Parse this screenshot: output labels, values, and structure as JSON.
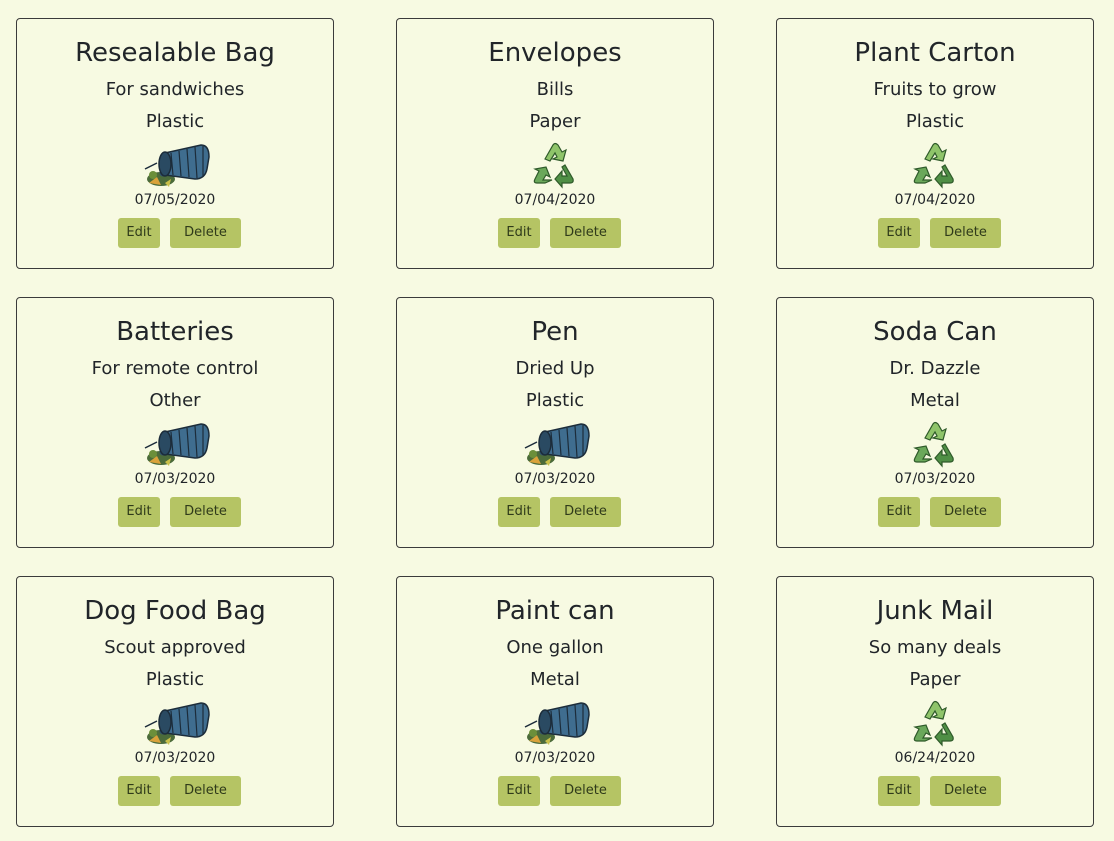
{
  "cards": [
    {
      "title": "Resealable Bag",
      "description": "For sandwiches",
      "material": "Plastic",
      "icon": "trash-can-icon",
      "date": "07/05/2020",
      "edit_label": "Edit",
      "delete_label": "Delete"
    },
    {
      "title": "Envelopes",
      "description": "Bills",
      "material": "Paper",
      "icon": "recycle-icon",
      "date": "07/04/2020",
      "edit_label": "Edit",
      "delete_label": "Delete"
    },
    {
      "title": "Plant Carton",
      "description": "Fruits to grow",
      "material": "Plastic",
      "icon": "recycle-icon",
      "date": "07/04/2020",
      "edit_label": "Edit",
      "delete_label": "Delete"
    },
    {
      "title": "Batteries",
      "description": "For remote control",
      "material": "Other",
      "icon": "trash-can-icon",
      "date": "07/03/2020",
      "edit_label": "Edit",
      "delete_label": "Delete"
    },
    {
      "title": "Pen",
      "description": "Dried Up",
      "material": "Plastic",
      "icon": "trash-can-icon",
      "date": "07/03/2020",
      "edit_label": "Edit",
      "delete_label": "Delete"
    },
    {
      "title": "Soda Can",
      "description": "Dr. Dazzle",
      "material": "Metal",
      "icon": "recycle-icon",
      "date": "07/03/2020",
      "edit_label": "Edit",
      "delete_label": "Delete"
    },
    {
      "title": "Dog Food Bag",
      "description": "Scout approved",
      "material": "Plastic",
      "icon": "trash-can-icon",
      "date": "07/03/2020",
      "edit_label": "Edit",
      "delete_label": "Delete"
    },
    {
      "title": "Paint can",
      "description": "One gallon",
      "material": "Metal",
      "icon": "trash-can-icon",
      "date": "07/03/2020",
      "edit_label": "Edit",
      "delete_label": "Delete"
    },
    {
      "title": "Junk Mail",
      "description": "So many deals",
      "material": "Paper",
      "icon": "recycle-icon",
      "date": "06/24/2020",
      "edit_label": "Edit",
      "delete_label": "Delete"
    }
  ],
  "colors": {
    "page_background": "#f7fae2",
    "button_background": "#b5c464",
    "trash_can": "#3f6d8f",
    "recycle_arrows": "#5a9a4a"
  }
}
